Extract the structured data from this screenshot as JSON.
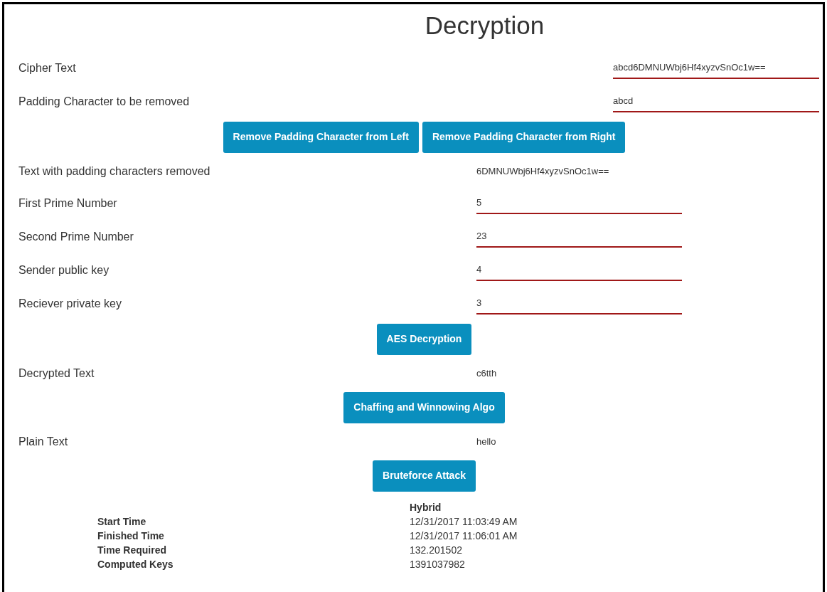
{
  "title": "Decryption",
  "rows": [
    {
      "kind": "wide-field",
      "label": "Cipher Text",
      "value": "abcd6DMNUWbj6Hf4xyzvSnOc1w=="
    },
    {
      "kind": "wide-field",
      "label": "Padding Character to be removed",
      "value": "abcd"
    },
    {
      "kind": "buttons",
      "buttons": [
        "Remove Padding Character from Left",
        "Remove Padding Character from Right"
      ]
    },
    {
      "kind": "value",
      "label": "Text with padding characters removed",
      "value": "6DMNUWbj6Hf4xyzvSnOc1w=="
    },
    {
      "kind": "field",
      "label": "First Prime Number",
      "value": "5"
    },
    {
      "kind": "field",
      "label": "Second Prime Number",
      "value": "23"
    },
    {
      "kind": "field",
      "label": "Sender public key",
      "value": "4"
    },
    {
      "kind": "field",
      "label": "Reciever private key",
      "value": "3"
    },
    {
      "kind": "buttons",
      "buttons": [
        "AES Decryption"
      ]
    },
    {
      "kind": "value",
      "label": "Decrypted Text",
      "value": "c6tth"
    },
    {
      "kind": "buttons",
      "buttons": [
        "Chaffing and Winnowing Algo"
      ]
    },
    {
      "kind": "value",
      "label": "Plain Text",
      "value": "hello"
    },
    {
      "kind": "buttons",
      "buttons": [
        "Bruteforce Attack"
      ]
    }
  ],
  "results": {
    "header": "Hybrid",
    "rows": [
      {
        "label": "Start Time",
        "value": "12/31/2017 11:03:49 AM"
      },
      {
        "label": "Finished Time",
        "value": "12/31/2017 11:06:01 AM"
      },
      {
        "label": "Time Required",
        "value": "132.201502"
      },
      {
        "label": "Computed Keys",
        "value": "1391037982"
      }
    ]
  }
}
